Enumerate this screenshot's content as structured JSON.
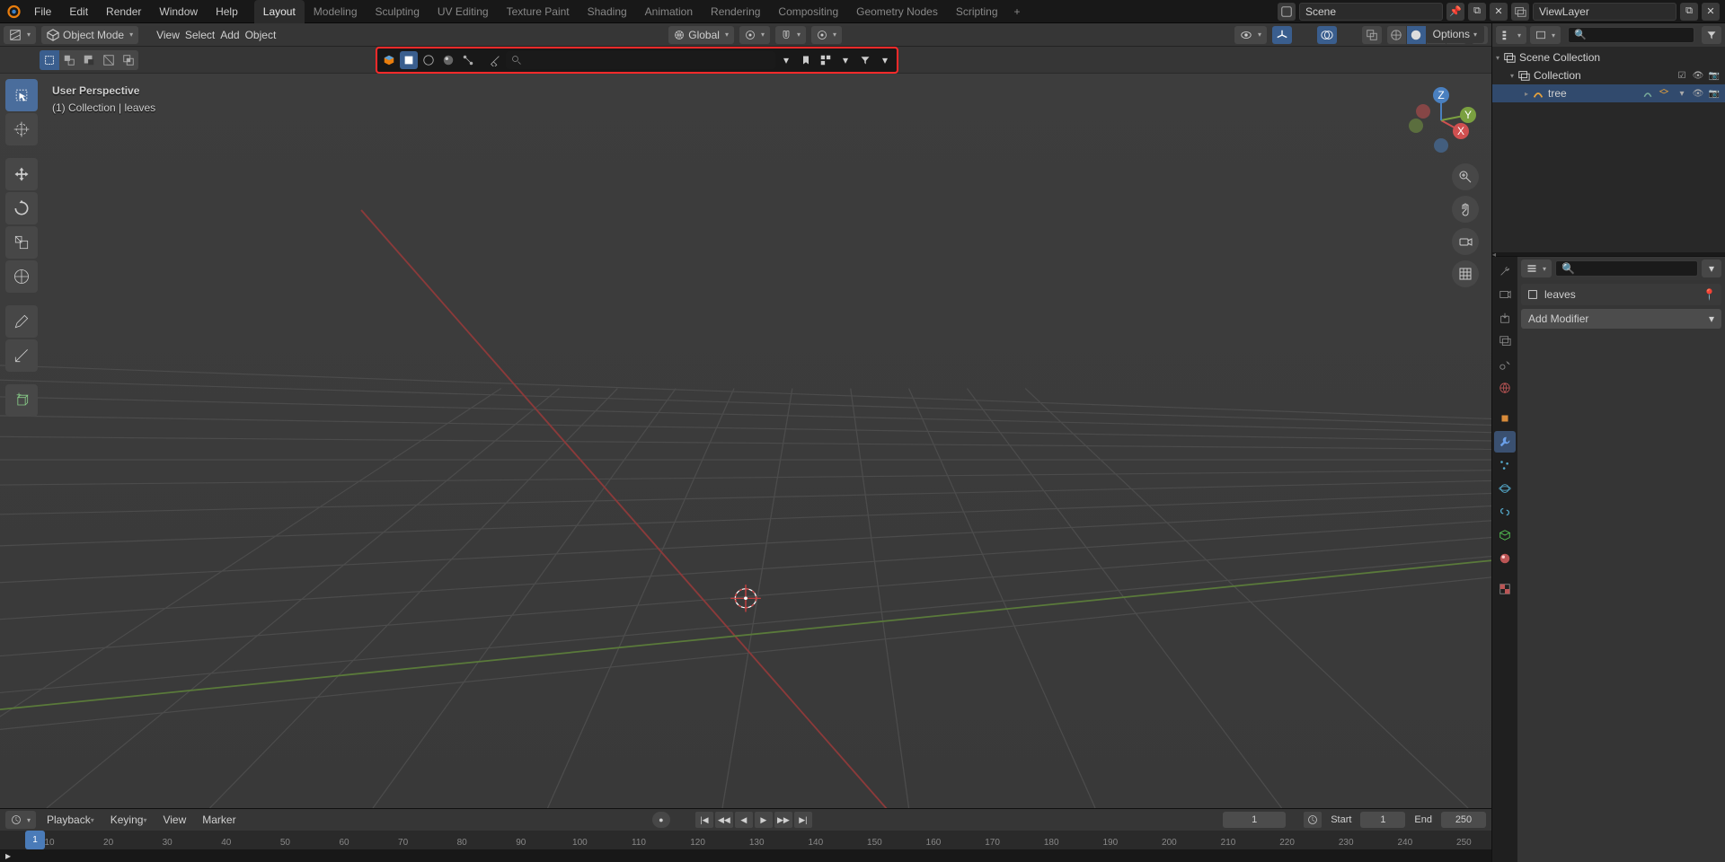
{
  "top_menu": [
    "File",
    "Edit",
    "Render",
    "Window",
    "Help"
  ],
  "workspaces": [
    "Layout",
    "Modeling",
    "Sculpting",
    "UV Editing",
    "Texture Paint",
    "Shading",
    "Animation",
    "Rendering",
    "Compositing",
    "Geometry Nodes",
    "Scripting"
  ],
  "active_workspace": 0,
  "scene_name": "Scene",
  "view_layer_name": "ViewLayer",
  "mode": "Object Mode",
  "view_menu": [
    "View",
    "Select",
    "Add",
    "Object"
  ],
  "orientation": "Global",
  "overlay_text": {
    "line1": "User Perspective",
    "line2": "(1) Collection | leaves"
  },
  "options_label": "Options",
  "outliner": {
    "root": "Scene Collection",
    "collection": "Collection",
    "object": "tree"
  },
  "properties": {
    "object_name": "leaves",
    "add_modifier": "Add Modifier"
  },
  "timeline": {
    "playback": "Playback",
    "keying": "Keying",
    "view": "View",
    "marker": "Marker",
    "current_frame": "1",
    "start_label": "Start",
    "start_val": "1",
    "end_label": "End",
    "end_val": "250",
    "ticks": [
      "10",
      "20",
      "30",
      "40",
      "50",
      "60",
      "70",
      "80",
      "90",
      "100",
      "110",
      "120",
      "130",
      "140",
      "150",
      "160",
      "170",
      "180",
      "190",
      "200",
      "210",
      "220",
      "230",
      "240",
      "250"
    ]
  }
}
